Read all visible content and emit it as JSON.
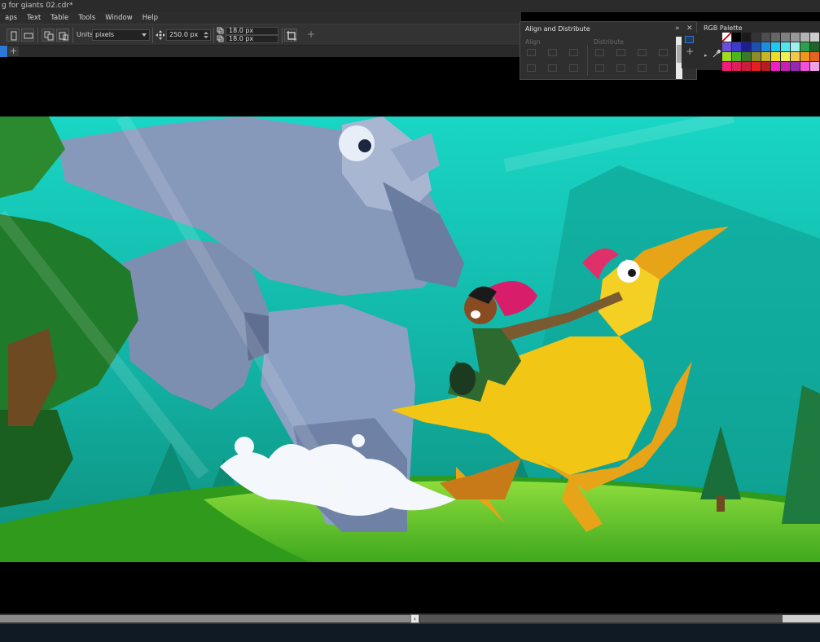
{
  "window": {
    "title": "g for giants 02.cdr*"
  },
  "menu": {
    "items": [
      "aps",
      "Text",
      "Table",
      "Tools",
      "Window",
      "Help"
    ]
  },
  "propertybar": {
    "units_label": "Units:",
    "units_value": "pixels",
    "nudge_value": "250.0 px",
    "duplicate_x": "18.0 px",
    "duplicate_y": "18.0 px"
  },
  "docker": {
    "title": "Align and Distribute",
    "align_label": "Align",
    "distribute_label": "Distribute",
    "expand_icon": "double-chevron-right-icon",
    "close_icon": "close-icon"
  },
  "palette": {
    "title": "RGB Palette",
    "colors": [
      "#ffffff",
      "#000000",
      "#1a1a1a",
      "#333333",
      "#4d4d4d",
      "#666666",
      "#808080",
      "#999999",
      "#b3b3b3",
      "#cccccc",
      "#e6e6e6",
      "#6b4fd8",
      "#3c3cc8",
      "#1e1e8c",
      "#1e50b4",
      "#1e8cdc",
      "#1ec8f0",
      "#50e6f0",
      "#a0f0f0",
      "#2da050",
      "#1e6428",
      "#e6e6e6",
      "#a0dc1e",
      "#50b41e",
      "#3c7828",
      "#8c8c28",
      "#c8b428",
      "#f0dc28",
      "#f0f050",
      "#f0c850",
      "#f0961e",
      "#e6641e",
      "#f0d8a0",
      "#f01e78",
      "#dc1e5a",
      "#c81e3c",
      "#e61e1e",
      "#b41e1e",
      "#f01ec8",
      "#c81eb4",
      "#9628b4",
      "#f050dc",
      "#f0a0e6",
      "#a0a0a0"
    ]
  },
  "document": {
    "add_tab": "+"
  },
  "colors": {
    "accent": "#2b78d6",
    "ui_bg": "#333333",
    "canvas_bg": "#000000"
  }
}
